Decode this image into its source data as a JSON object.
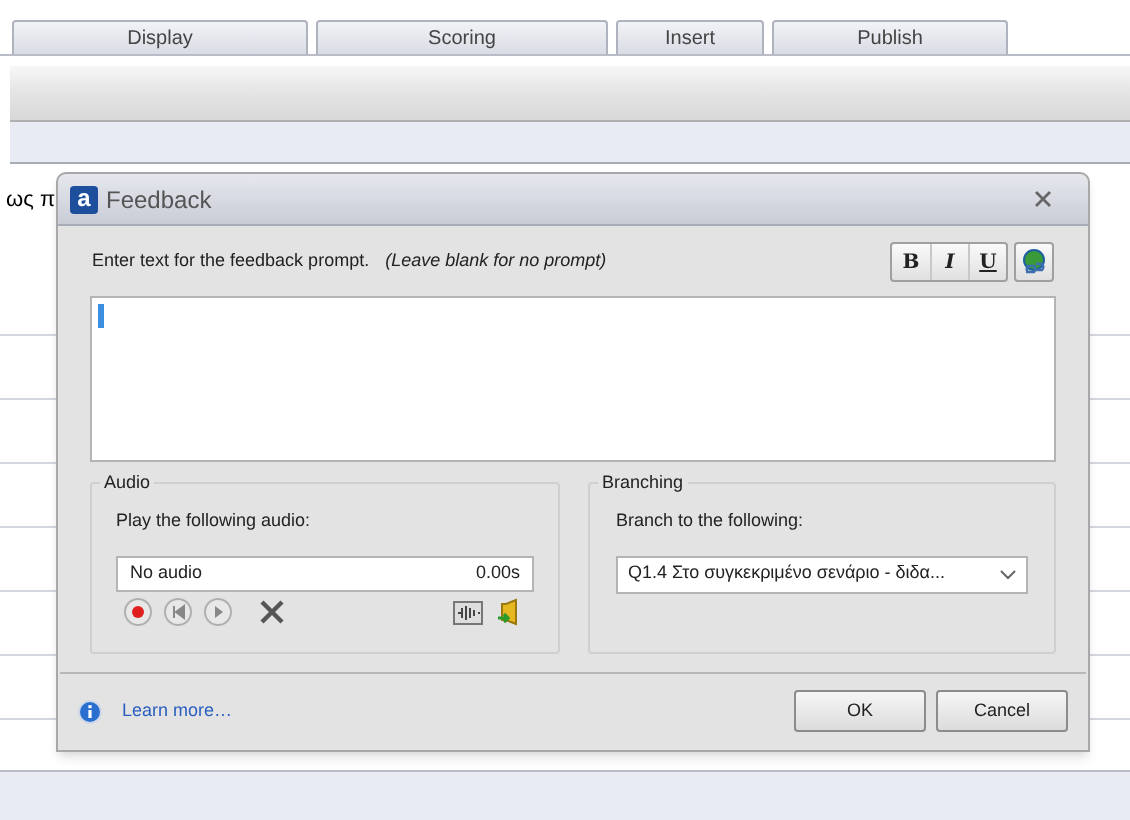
{
  "tabs": [
    {
      "label": "Display"
    },
    {
      "label": "Scoring"
    },
    {
      "label": "Insert"
    },
    {
      "label": "Publish"
    }
  ],
  "background_text": "ως π",
  "dialog": {
    "logo": "a",
    "title": "Feedback",
    "prompt_label": "Enter text for the feedback prompt.",
    "prompt_hint": "(Leave blank for no prompt)",
    "format_buttons": [
      {
        "label": "B",
        "kind": "bold"
      },
      {
        "label": "I",
        "kind": "italic"
      },
      {
        "label": "U",
        "kind": "underline"
      }
    ],
    "audio": {
      "title": "Audio",
      "label": "Play the following audio:",
      "file": "No audio",
      "duration": "0.00s"
    },
    "branching": {
      "title": "Branching",
      "label": "Branch to the following:",
      "value": "Q1.4 Στο συγκεκριμένο σενάριο - διδα..."
    },
    "learn_more": "Learn more…",
    "buttons": [
      "OK",
      "Cancel"
    ]
  }
}
